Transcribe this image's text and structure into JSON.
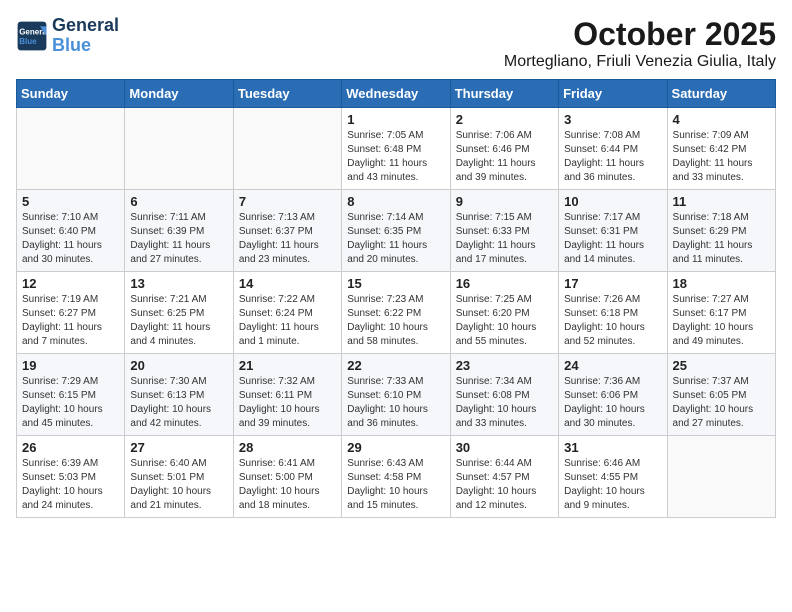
{
  "header": {
    "logo_line1": "General",
    "logo_line2": "Blue",
    "month": "October 2025",
    "location": "Mortegliano, Friuli Venezia Giulia, Italy"
  },
  "weekdays": [
    "Sunday",
    "Monday",
    "Tuesday",
    "Wednesday",
    "Thursday",
    "Friday",
    "Saturday"
  ],
  "weeks": [
    [
      {
        "day": "",
        "info": ""
      },
      {
        "day": "",
        "info": ""
      },
      {
        "day": "",
        "info": ""
      },
      {
        "day": "1",
        "info": "Sunrise: 7:05 AM\nSunset: 6:48 PM\nDaylight: 11 hours and 43 minutes."
      },
      {
        "day": "2",
        "info": "Sunrise: 7:06 AM\nSunset: 6:46 PM\nDaylight: 11 hours and 39 minutes."
      },
      {
        "day": "3",
        "info": "Sunrise: 7:08 AM\nSunset: 6:44 PM\nDaylight: 11 hours and 36 minutes."
      },
      {
        "day": "4",
        "info": "Sunrise: 7:09 AM\nSunset: 6:42 PM\nDaylight: 11 hours and 33 minutes."
      }
    ],
    [
      {
        "day": "5",
        "info": "Sunrise: 7:10 AM\nSunset: 6:40 PM\nDaylight: 11 hours and 30 minutes."
      },
      {
        "day": "6",
        "info": "Sunrise: 7:11 AM\nSunset: 6:39 PM\nDaylight: 11 hours and 27 minutes."
      },
      {
        "day": "7",
        "info": "Sunrise: 7:13 AM\nSunset: 6:37 PM\nDaylight: 11 hours and 23 minutes."
      },
      {
        "day": "8",
        "info": "Sunrise: 7:14 AM\nSunset: 6:35 PM\nDaylight: 11 hours and 20 minutes."
      },
      {
        "day": "9",
        "info": "Sunrise: 7:15 AM\nSunset: 6:33 PM\nDaylight: 11 hours and 17 minutes."
      },
      {
        "day": "10",
        "info": "Sunrise: 7:17 AM\nSunset: 6:31 PM\nDaylight: 11 hours and 14 minutes."
      },
      {
        "day": "11",
        "info": "Sunrise: 7:18 AM\nSunset: 6:29 PM\nDaylight: 11 hours and 11 minutes."
      }
    ],
    [
      {
        "day": "12",
        "info": "Sunrise: 7:19 AM\nSunset: 6:27 PM\nDaylight: 11 hours and 7 minutes."
      },
      {
        "day": "13",
        "info": "Sunrise: 7:21 AM\nSunset: 6:25 PM\nDaylight: 11 hours and 4 minutes."
      },
      {
        "day": "14",
        "info": "Sunrise: 7:22 AM\nSunset: 6:24 PM\nDaylight: 11 hours and 1 minute."
      },
      {
        "day": "15",
        "info": "Sunrise: 7:23 AM\nSunset: 6:22 PM\nDaylight: 10 hours and 58 minutes."
      },
      {
        "day": "16",
        "info": "Sunrise: 7:25 AM\nSunset: 6:20 PM\nDaylight: 10 hours and 55 minutes."
      },
      {
        "day": "17",
        "info": "Sunrise: 7:26 AM\nSunset: 6:18 PM\nDaylight: 10 hours and 52 minutes."
      },
      {
        "day": "18",
        "info": "Sunrise: 7:27 AM\nSunset: 6:17 PM\nDaylight: 10 hours and 49 minutes."
      }
    ],
    [
      {
        "day": "19",
        "info": "Sunrise: 7:29 AM\nSunset: 6:15 PM\nDaylight: 10 hours and 45 minutes."
      },
      {
        "day": "20",
        "info": "Sunrise: 7:30 AM\nSunset: 6:13 PM\nDaylight: 10 hours and 42 minutes."
      },
      {
        "day": "21",
        "info": "Sunrise: 7:32 AM\nSunset: 6:11 PM\nDaylight: 10 hours and 39 minutes."
      },
      {
        "day": "22",
        "info": "Sunrise: 7:33 AM\nSunset: 6:10 PM\nDaylight: 10 hours and 36 minutes."
      },
      {
        "day": "23",
        "info": "Sunrise: 7:34 AM\nSunset: 6:08 PM\nDaylight: 10 hours and 33 minutes."
      },
      {
        "day": "24",
        "info": "Sunrise: 7:36 AM\nSunset: 6:06 PM\nDaylight: 10 hours and 30 minutes."
      },
      {
        "day": "25",
        "info": "Sunrise: 7:37 AM\nSunset: 6:05 PM\nDaylight: 10 hours and 27 minutes."
      }
    ],
    [
      {
        "day": "26",
        "info": "Sunrise: 6:39 AM\nSunset: 5:03 PM\nDaylight: 10 hours and 24 minutes."
      },
      {
        "day": "27",
        "info": "Sunrise: 6:40 AM\nSunset: 5:01 PM\nDaylight: 10 hours and 21 minutes."
      },
      {
        "day": "28",
        "info": "Sunrise: 6:41 AM\nSunset: 5:00 PM\nDaylight: 10 hours and 18 minutes."
      },
      {
        "day": "29",
        "info": "Sunrise: 6:43 AM\nSunset: 4:58 PM\nDaylight: 10 hours and 15 minutes."
      },
      {
        "day": "30",
        "info": "Sunrise: 6:44 AM\nSunset: 4:57 PM\nDaylight: 10 hours and 12 minutes."
      },
      {
        "day": "31",
        "info": "Sunrise: 6:46 AM\nSunset: 4:55 PM\nDaylight: 10 hours and 9 minutes."
      },
      {
        "day": "",
        "info": ""
      }
    ]
  ]
}
